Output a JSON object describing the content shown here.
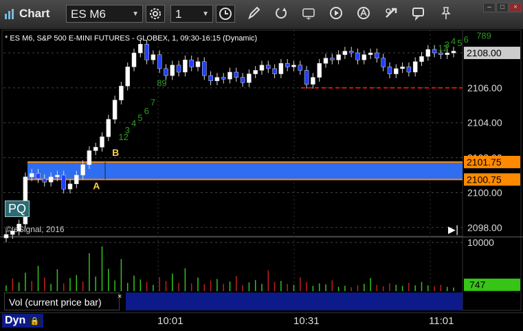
{
  "window": {
    "title": "Chart",
    "symbol": "ES M6",
    "interval": "1"
  },
  "toolbar": {
    "icons": [
      "settings-icon",
      "clock-icon",
      "pencil-icon",
      "refresh-icon",
      "get-icon",
      "play-icon",
      "alert-icon",
      "tools-icon",
      "chat-icon",
      "pin-icon"
    ]
  },
  "colors": {
    "blue_band": "#2f6ef0",
    "orange": "#ff8a00",
    "red_line": "#e01010",
    "up_vol": "#34c41c",
    "down_vol": "#c02020",
    "flag": "#2f9a22"
  },
  "chart_data": [
    {
      "type": "candlestick",
      "title": "* ES M6, S&P 500 E-MINI FUTURES - GLOBEX, 1, 09:30-16:15 (Dynamic)",
      "ylim": [
        2097.5,
        2109.3
      ],
      "y_ticks": [
        "2098.00",
        "2100.00",
        "2102.00",
        "2104.00",
        "2106.00",
        "2108.00"
      ],
      "x_ticks": [
        "10:01",
        "10:31",
        "11:01"
      ],
      "current_price": "2108.00",
      "series": [
        {
          "name": "price",
          "values": [
            2097.6,
            2097.8,
            2098.2,
            2100.9,
            2101.1,
            2100.8,
            2100.6,
            2100.9,
            2101.0,
            2100.2,
            2100.5,
            2101.0,
            2101.6,
            2102.4,
            2102.6,
            2103.2,
            2104.2,
            2105.3,
            2106.1,
            2107.2,
            2108.0,
            2108.5,
            2107.6,
            2107.9,
            2107.1,
            2106.7,
            2107.3,
            2106.9,
            2107.6,
            2107.2,
            2107.5,
            2106.7,
            2106.4,
            2106.6,
            2106.5,
            2106.9,
            2106.6,
            2106.3,
            2106.8,
            2107.0,
            2107.3,
            2107.1,
            2106.8,
            2107.4,
            2107.2,
            2107.3,
            2107.0,
            2106.2,
            2106.6,
            2107.4,
            2107.7,
            2107.6,
            2107.9,
            2108.1,
            2108.0,
            2107.6,
            2107.9,
            2108.0,
            2107.7,
            2107.2,
            2106.8,
            2107.1,
            2107.2,
            2106.9,
            2107.5,
            2107.8,
            2108.2,
            2108.0,
            2107.9,
            2108.0,
            2108.1
          ]
        }
      ],
      "levels": [
        {
          "label": "2101.75",
          "value": 2101.75,
          "color": "orange"
        },
        {
          "label": "2100.75",
          "value": 2100.75,
          "color": "orange"
        },
        {
          "label": "",
          "value": 2106.0,
          "color": "red"
        }
      ],
      "annotations": [
        {
          "text": "A",
          "x": 14,
          "y": 2100.2
        },
        {
          "text": "B",
          "x": 17,
          "y": 2102.1
        },
        {
          "text": "12",
          "x": 18,
          "y": 2103.0
        },
        {
          "text": "3",
          "x": 19,
          "y": 2103.4
        },
        {
          "text": "4",
          "x": 20,
          "y": 2103.8
        },
        {
          "text": "5",
          "x": 21,
          "y": 2104.1
        },
        {
          "text": "6",
          "x": 22,
          "y": 2104.5
        },
        {
          "text": "7",
          "x": 23,
          "y": 2105.0
        },
        {
          "text": "89",
          "x": 24,
          "y": 2106.1
        },
        {
          "text": "12",
          "x": 68,
          "y": 2108.1
        },
        {
          "text": "3",
          "x": 69,
          "y": 2108.3
        },
        {
          "text": "4",
          "x": 70,
          "y": 2108.5
        },
        {
          "text": "5",
          "x": 71,
          "y": 2108.4
        },
        {
          "text": "6",
          "x": 72,
          "y": 2108.6
        },
        {
          "text": "789",
          "x": 74,
          "y": 2108.8
        }
      ]
    },
    {
      "type": "bar",
      "title": "Vol (current price bar)",
      "y_ticks": [
        "10000"
      ],
      "current_value": "747",
      "values": [
        1200,
        2600,
        1800,
        3800,
        2100,
        5200,
        2800,
        1500,
        4500,
        1600,
        2700,
        3300,
        2000,
        7800,
        3000,
        9200,
        4600,
        2200,
        6600,
        1700,
        3200,
        2400,
        1900,
        1300,
        2900,
        2100,
        3600,
        1700,
        4700,
        1600,
        2800,
        1400,
        2200,
        2500,
        1500,
        2000,
        3100,
        1200,
        1800,
        2300,
        1500,
        4300,
        1900,
        2100,
        1500,
        1300,
        2800,
        1900,
        1100,
        1600,
        1400,
        2200,
        900,
        1100,
        800,
        1200,
        1500,
        2700,
        1300,
        1000,
        1600,
        1300,
        1100,
        1700,
        1200,
        1900,
        1200,
        1000,
        1300,
        900,
        747
      ],
      "up": [
        1,
        0,
        1,
        1,
        0,
        1,
        0,
        1,
        1,
        0,
        1,
        1,
        0,
        1,
        1,
        1,
        1,
        1,
        1,
        1,
        1,
        1,
        0,
        1,
        0,
        0,
        1,
        0,
        1,
        0,
        1,
        0,
        0,
        1,
        0,
        1,
        0,
        0,
        1,
        1,
        1,
        0,
        0,
        1,
        0,
        1,
        0,
        0,
        1,
        1,
        1,
        0,
        1,
        1,
        0,
        0,
        1,
        1,
        0,
        0,
        0,
        1,
        1,
        0,
        1,
        1,
        1,
        0,
        0,
        1,
        1
      ]
    }
  ],
  "panel": {
    "copyright": "© eSignal, 2016",
    "pq_badge": "PQ",
    "dyn_label": "Dyn"
  }
}
